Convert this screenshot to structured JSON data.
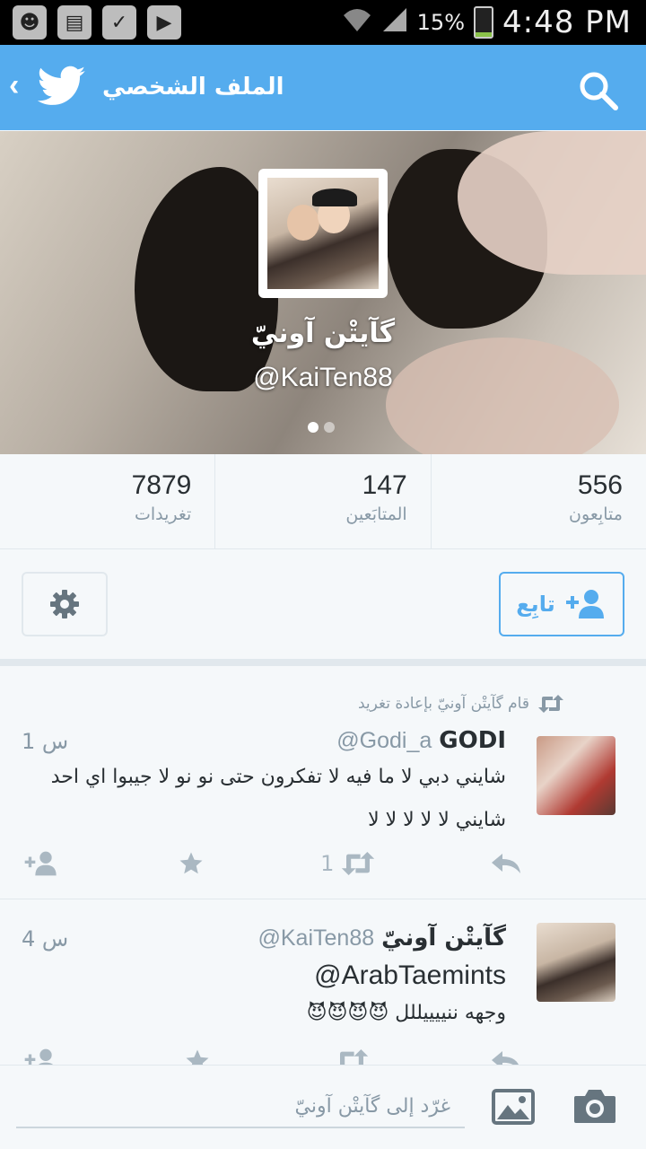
{
  "status_bar": {
    "battery": "15%",
    "time": "4:48 PM",
    "icons": [
      "app-icon",
      "sd-card-icon",
      "checkbox-icon",
      "play-store-icon",
      "wifi-icon",
      "signal-icon",
      "battery-icon"
    ]
  },
  "app_bar": {
    "title": "الملف الشخصي",
    "icons": [
      "back-chevron-icon",
      "twitter-bird-icon",
      "search-icon"
    ]
  },
  "profile": {
    "name": "گآيتْن آونيّ",
    "handle": "@KaiTen88"
  },
  "stats": [
    {
      "value": "556",
      "label": "متابِعون"
    },
    {
      "value": "147",
      "label": "المتابَعين"
    },
    {
      "value": "7879",
      "label": "تغريدات"
    }
  ],
  "actions": {
    "follow_label": "تابِع"
  },
  "tweets": [
    {
      "retweet_line": "قام گآيتْن آونيّ بإعادة تغريد",
      "name": "GODI",
      "handle": "@Godi_a",
      "time": "1 س",
      "text": "شايني دبي لا ما فيه لا تفكرون حتى نو نو لا جيبوا اي احد شايني لا لا لا لا لا",
      "retweet_count": "1"
    },
    {
      "name": "گآيتْن آونيّ",
      "handle": "@KaiTen88",
      "time": "4 س",
      "mention": "@ArabTaemints",
      "text": "وجهه ننييييللل 😈😈😈😈"
    }
  ],
  "compose": {
    "placeholder": "غرّد إلى گآيتْن آونيّ"
  },
  "colors": {
    "accent": "#55acee",
    "text": "#292f33",
    "muted": "#8899a6",
    "background": "#f5f8fa"
  }
}
